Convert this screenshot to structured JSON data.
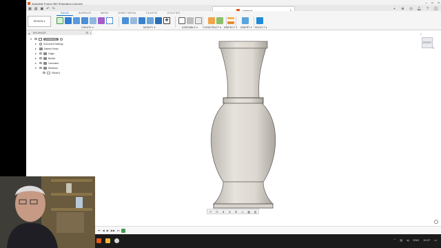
{
  "window": {
    "title": "Autodesk Fusion 360 (Education License)",
    "controls": [
      "–",
      "□",
      "×"
    ]
  },
  "document_tab": {
    "name": "Untitled*",
    "close": "×"
  },
  "header_icons": [
    "add-tab-icon",
    "extensions-icon",
    "job-status-icon",
    "notifications-icon",
    "help-icon",
    "user-avatar"
  ],
  "workspace": {
    "label": "DESIGN ▾"
  },
  "toolbar_tabs": [
    {
      "label": "SOLID",
      "active": true
    },
    {
      "label": "SURFACE",
      "active": false
    },
    {
      "label": "MESH",
      "active": false
    },
    {
      "label": "SHEET METAL",
      "active": false
    },
    {
      "label": "PLASTIC",
      "active": false
    },
    {
      "label": "UTILITIES",
      "active": false
    }
  ],
  "toolbar_groups": [
    {
      "label": "CREATE ▾"
    },
    {
      "label": "MODIFY ▾"
    },
    {
      "label": "ASSEMBLE ▾"
    },
    {
      "label": "CONSTRUCT ▾"
    },
    {
      "label": "INSPECT ▾"
    },
    {
      "label": "INSERT ▾"
    },
    {
      "label": "SELECT ▾"
    }
  ],
  "browser": {
    "title": "BROWSER",
    "root": "(Unsaved)",
    "nodes": [
      {
        "label": "Document Settings"
      },
      {
        "label": "Named Views"
      },
      {
        "label": "Origin"
      },
      {
        "label": "Bodies"
      },
      {
        "label": "Canvases"
      },
      {
        "label": "Sketches"
      },
      {
        "label": "Sketch1"
      }
    ]
  },
  "viewcube": {
    "face": "FRONT",
    "z_axis": "Z",
    "x_axis": "X"
  },
  "colors": {
    "accent": "#0a6ac9",
    "body": "#e3dfd9",
    "body_edge": "#6b6660",
    "taskbar": "#1b1b1b"
  },
  "taskbar": {
    "language": "ENG",
    "time": "19:27"
  }
}
